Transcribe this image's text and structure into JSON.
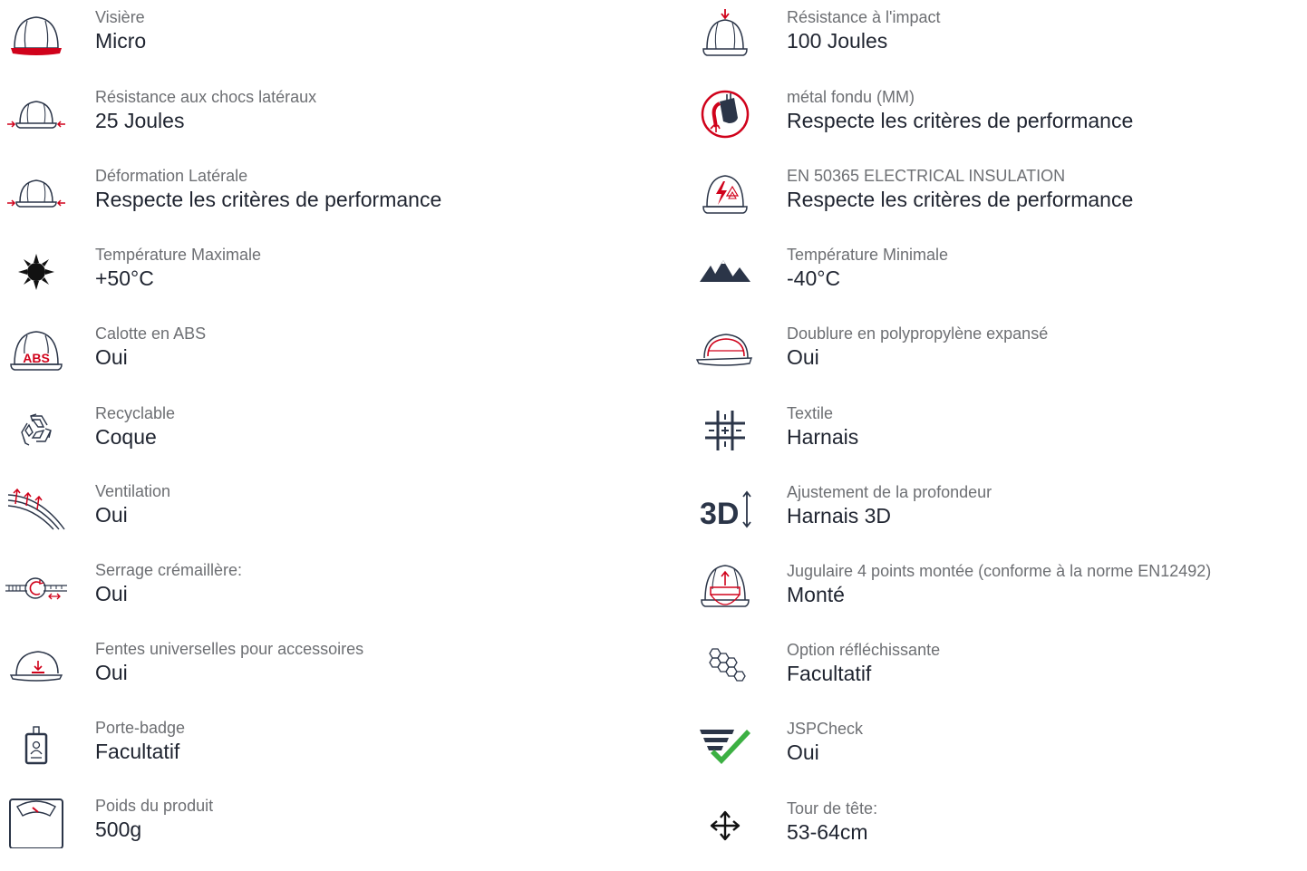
{
  "colors": {
    "accent": "#d0021b",
    "navy": "#2b3548",
    "green": "#3cb043",
    "label": "#6d6f73",
    "value": "#1f2430"
  },
  "left": [
    {
      "icon": "helmet-visor-icon",
      "label": "Visière",
      "value": "Micro"
    },
    {
      "icon": "side-impact-icon",
      "label": "Résistance aux chocs latéraux",
      "value": "25 Joules"
    },
    {
      "icon": "lateral-deformation-icon",
      "label": "Déformation Latérale",
      "value": "Respecte les critères de performance"
    },
    {
      "icon": "sun-icon",
      "label": "Température Maximale",
      "value": "+50°C"
    },
    {
      "icon": "abs-shell-icon",
      "label": "Calotte en ABS",
      "value": "Oui",
      "badge": "ABS"
    },
    {
      "icon": "recycle-icon",
      "label": "Recyclable",
      "value": "Coque"
    },
    {
      "icon": "ventilation-icon",
      "label": "Ventilation",
      "value": "Oui"
    },
    {
      "icon": "ratchet-icon",
      "label": "Serrage crémaillère:",
      "value": "Oui"
    },
    {
      "icon": "accessory-slot-icon",
      "label": "Fentes universelles pour accessoires",
      "value": "Oui"
    },
    {
      "icon": "badge-holder-icon",
      "label": "Porte-badge",
      "value": "Facultatif"
    },
    {
      "icon": "weight-scale-icon",
      "label": "Poids du produit",
      "value": "500g"
    }
  ],
  "right": [
    {
      "icon": "impact-icon",
      "label": "Résistance à l'impact",
      "value": "100 Joules"
    },
    {
      "icon": "molten-metal-icon",
      "label": "métal fondu (MM)",
      "value": "Respecte les critères de performance"
    },
    {
      "icon": "electrical-insulation-icon",
      "label": "EN 50365 ELECTRICAL INSULATION",
      "value": "Respecte les critères de performance"
    },
    {
      "icon": "mountains-icon",
      "label": "Température Minimale",
      "value": "-40°C"
    },
    {
      "icon": "eps-liner-icon",
      "label": "Doublure en polypropylène expansé",
      "value": "Oui"
    },
    {
      "icon": "textile-icon",
      "label": "Textile",
      "value": "Harnais"
    },
    {
      "icon": "depth-adjust-3d-icon",
      "label": "Ajustement de la profondeur",
      "value": "Harnais 3D",
      "badge": "3D"
    },
    {
      "icon": "chinstrap-icon",
      "label": "Jugulaire 4 points montée (conforme à la norme EN12492)",
      "value": "Monté"
    },
    {
      "icon": "reflective-option-icon",
      "label": "Option réfléchissante",
      "value": "Facultatif"
    },
    {
      "icon": "jspcheck-icon",
      "label": "JSPCheck",
      "value": "Oui"
    },
    {
      "icon": "move-arrows-icon",
      "label": "Tour de tête:",
      "value": "53-64cm"
    }
  ]
}
